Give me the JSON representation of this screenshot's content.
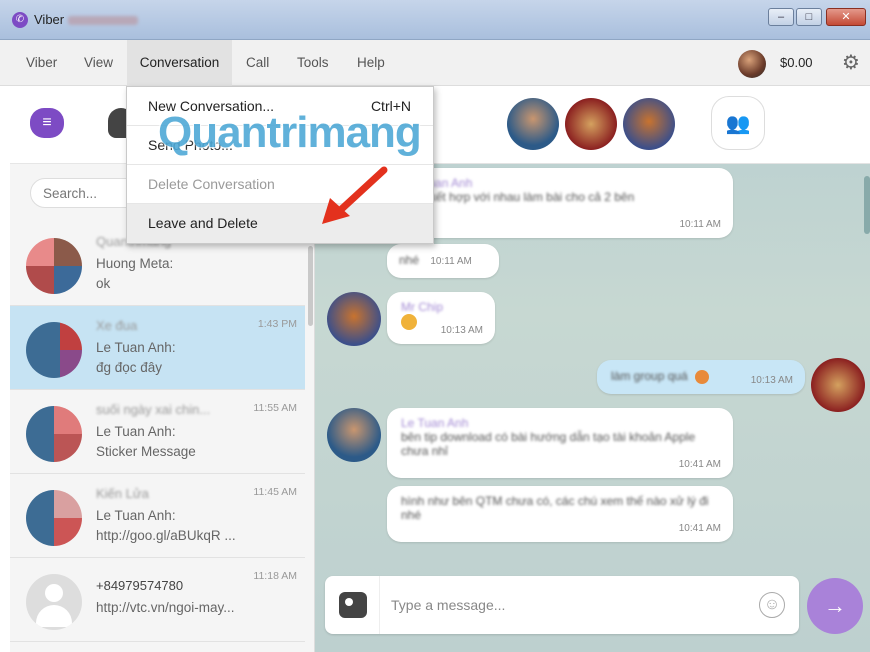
{
  "window": {
    "title": "Viber"
  },
  "menubar": {
    "items": [
      "Viber",
      "View",
      "Conversation",
      "Call",
      "Tools",
      "Help"
    ],
    "balance": "$0.00"
  },
  "dropdown": {
    "items": [
      {
        "label": "New Conversation...",
        "shortcut": "Ctrl+N",
        "state": "normal"
      },
      {
        "label": "Send Photo...",
        "shortcut": "",
        "state": "normal"
      },
      {
        "label": "Delete Conversation",
        "shortcut": "",
        "state": "disabled"
      },
      {
        "label": "Leave and Delete",
        "shortcut": "",
        "state": "hover"
      }
    ]
  },
  "watermark": "Quantrimang",
  "search": {
    "placeholder": "Search..."
  },
  "conversations": [
    {
      "name": "Quantrimang",
      "sender": "Huong Meta:",
      "message": "ok",
      "time": ""
    },
    {
      "name": "Xe đua",
      "sender": "Le Tuan Anh:",
      "message": "đg đọc đây",
      "time": "1:43 PM"
    },
    {
      "name": "suối ngày xai chin...",
      "sender": "Le Tuan Anh:",
      "message": "Sticker Message",
      "time": "11:55 AM"
    },
    {
      "name": "Kiến Lửa",
      "sender": "Le Tuan Anh:",
      "message": "http://goo.gl/aBUkqR ...",
      "time": "11:45 AM"
    },
    {
      "name": "+84979574780",
      "sender": "",
      "message": "http://vtc.vn/ngoi-may...",
      "time": "11:18 AM"
    }
  ],
  "messages": [
    {
      "author": "Le Tuan Anh",
      "text": "ừng kết hợp với nhau làm bài cho cả 2 bên",
      "time": "10:11 AM",
      "direction": "in"
    },
    {
      "author": "",
      "text": "nhé",
      "time": "10:11 AM",
      "direction": "in"
    },
    {
      "author": "Mr Chip",
      "text": "",
      "time": "10:13 AM",
      "direction": "in"
    },
    {
      "author": "",
      "text": "làm group quá",
      "time": "10:13 AM",
      "direction": "out"
    },
    {
      "author": "Le Tuan Anh",
      "text": "bên tip download có bài hướng dẫn tạo tài khoản Apple chưa nhỉ",
      "time": "10:41 AM",
      "direction": "in"
    },
    {
      "author": "",
      "text": "hình như bên QTM chưa có, các chú xem thế nào xử lý đi nhé",
      "time": "10:41 AM",
      "direction": "in"
    }
  ],
  "composer": {
    "placeholder": "Type a message..."
  },
  "colors": {
    "accent": "#7d4bc4",
    "selected_row": "#c6e3f3",
    "send_button": "#a982d9"
  }
}
